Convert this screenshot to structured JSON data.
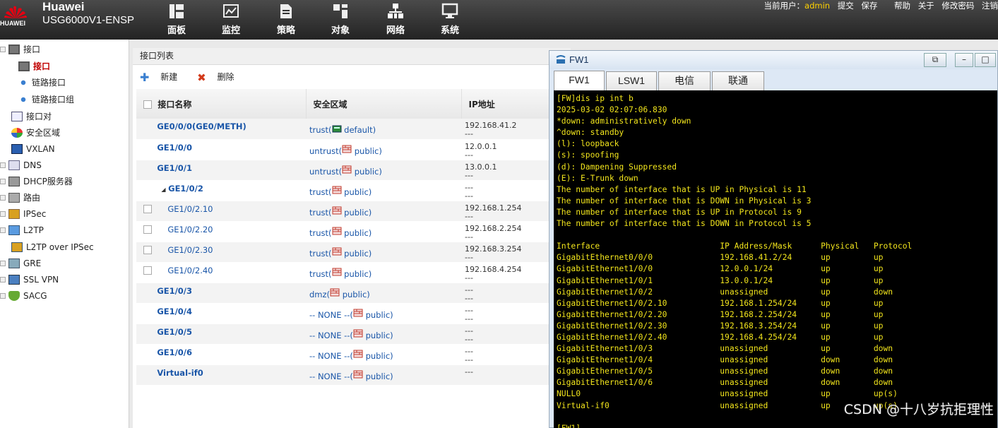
{
  "brand": {
    "company": "Huawei",
    "logo_text": "HUAWEI",
    "model": "USG6000V1-ENSP"
  },
  "nav": [
    {
      "label": "面板",
      "icon": "dashboard-icon"
    },
    {
      "label": "监控",
      "icon": "monitor-icon"
    },
    {
      "label": "策略",
      "icon": "policy-icon"
    },
    {
      "label": "对象",
      "icon": "object-icon"
    },
    {
      "label": "网络",
      "icon": "network-icon",
      "active": true
    },
    {
      "label": "系统",
      "icon": "system-icon"
    }
  ],
  "topright": {
    "user_label": "当前用户：",
    "user": "admin",
    "commit": "提交",
    "save": "保存",
    "help": "帮助",
    "about": "关于",
    "change_pwd": "修改密码",
    "logout": "注销"
  },
  "sidebar": {
    "items": [
      {
        "label": "接口"
      },
      {
        "label": "接口"
      },
      {
        "label": "链路接口"
      },
      {
        "label": "链路接口组"
      },
      {
        "label": "接口对"
      },
      {
        "label": "安全区域"
      },
      {
        "label": "VXLAN"
      },
      {
        "label": "DNS"
      },
      {
        "label": "DHCP服务器"
      },
      {
        "label": "路由"
      },
      {
        "label": "IPSec"
      },
      {
        "label": "L2TP"
      },
      {
        "label": "L2TP over IPSec"
      },
      {
        "label": "GRE"
      },
      {
        "label": "SSL VPN"
      },
      {
        "label": "SACG"
      }
    ]
  },
  "content": {
    "title": "接口列表",
    "new_label": "新建",
    "delete_label": "删除",
    "columns": [
      "接口名称",
      "安全区域",
      "IP地址"
    ],
    "rows": [
      {
        "name": "GE0/0/0(GE0/METH)",
        "zone_prefix": "trust(",
        "zone": "default)",
        "ip": "192.168.41.2",
        "ip2": "---"
      },
      {
        "name": "GE1/0/0",
        "zone_prefix": "untrust(",
        "zone": "public)",
        "ip": "12.0.0.1",
        "ip2": "---"
      },
      {
        "name": "GE1/0/1",
        "zone_prefix": "untrust(",
        "zone": "public)",
        "ip": "13.0.0.1",
        "ip2": "---"
      },
      {
        "name": "GE1/0/2",
        "zone_prefix": "trust(",
        "zone": "public)",
        "ip": "---",
        "ip2": "---"
      },
      {
        "name": "GE1/0/2.10",
        "zone_prefix": "trust(",
        "zone": "public)",
        "ip": "192.168.1.254",
        "ip2": "---"
      },
      {
        "name": "GE1/0/2.20",
        "zone_prefix": "trust(",
        "zone": "public)",
        "ip": "192.168.2.254",
        "ip2": "---"
      },
      {
        "name": "GE1/0/2.30",
        "zone_prefix": "trust(",
        "zone": "public)",
        "ip": "192.168.3.254",
        "ip2": "---"
      },
      {
        "name": "GE1/0/2.40",
        "zone_prefix": "trust(",
        "zone": "public)",
        "ip": "192.168.4.254",
        "ip2": "---"
      },
      {
        "name": "GE1/0/3",
        "zone_prefix": "dmz(",
        "zone": "public)",
        "ip": "---",
        "ip2": "---"
      },
      {
        "name": "GE1/0/4",
        "zone_prefix": "-- NONE --(",
        "zone": "public)",
        "ip": "---",
        "ip2": "---"
      },
      {
        "name": "GE1/0/5",
        "zone_prefix": "-- NONE --(",
        "zone": "public)",
        "ip": "---",
        "ip2": "---"
      },
      {
        "name": "GE1/0/6",
        "zone_prefix": "-- NONE --(",
        "zone": "public)",
        "ip": "---",
        "ip2": "---"
      },
      {
        "name": "Virtual-if0",
        "zone_prefix": "-- NONE --(",
        "zone": "public)",
        "ip": "---",
        "ip2": ""
      }
    ]
  },
  "terminal": {
    "title": "FW1",
    "tabs": [
      "FW1",
      "LSW1",
      "电信",
      "联通"
    ],
    "output": "[FW]dis ip int b\n2025-03-02 02:07:06.830\n*down: administratively down\n^down: standby\n(l): loopback\n(s): spoofing\n(d): Dampening Suppressed\n(E): E-Trunk down\nThe number of interface that is UP in Physical is 11\nThe number of interface that is DOWN in Physical is 3\nThe number of interface that is UP in Protocol is 9\nThe number of interface that is DOWN in Protocol is 5\n\nInterface                         IP Address/Mask      Physical   Protocol\nGigabitEthernet0/0/0              192.168.41.2/24      up         up\nGigabitEthernet1/0/0              12.0.0.1/24          up         up\nGigabitEthernet1/0/1              13.0.0.1/24          up         up\nGigabitEthernet1/0/2              unassigned           up         down\nGigabitEthernet1/0/2.10           192.168.1.254/24     up         up\nGigabitEthernet1/0/2.20           192.168.2.254/24     up         up\nGigabitEthernet1/0/2.30           192.168.3.254/24     up         up\nGigabitEthernet1/0/2.40           192.168.4.254/24     up         up\nGigabitEthernet1/0/3              unassigned           up         down\nGigabitEthernet1/0/4              unassigned           down       down\nGigabitEthernet1/0/5              unassigned           down       down\nGigabitEthernet1/0/6              unassigned           down       down\nNULL0                             unassigned           up         up(s)\nVirtual-if0                       unassigned           up         up(s)\n\n[FW1]"
  },
  "watermark": "CSDN @十八岁抗拒理性",
  "colors": {
    "topbar": "#2e2e2e",
    "terminal_text": "#f2e51c",
    "link": "#1a56a8",
    "active_side": "#c00000"
  }
}
